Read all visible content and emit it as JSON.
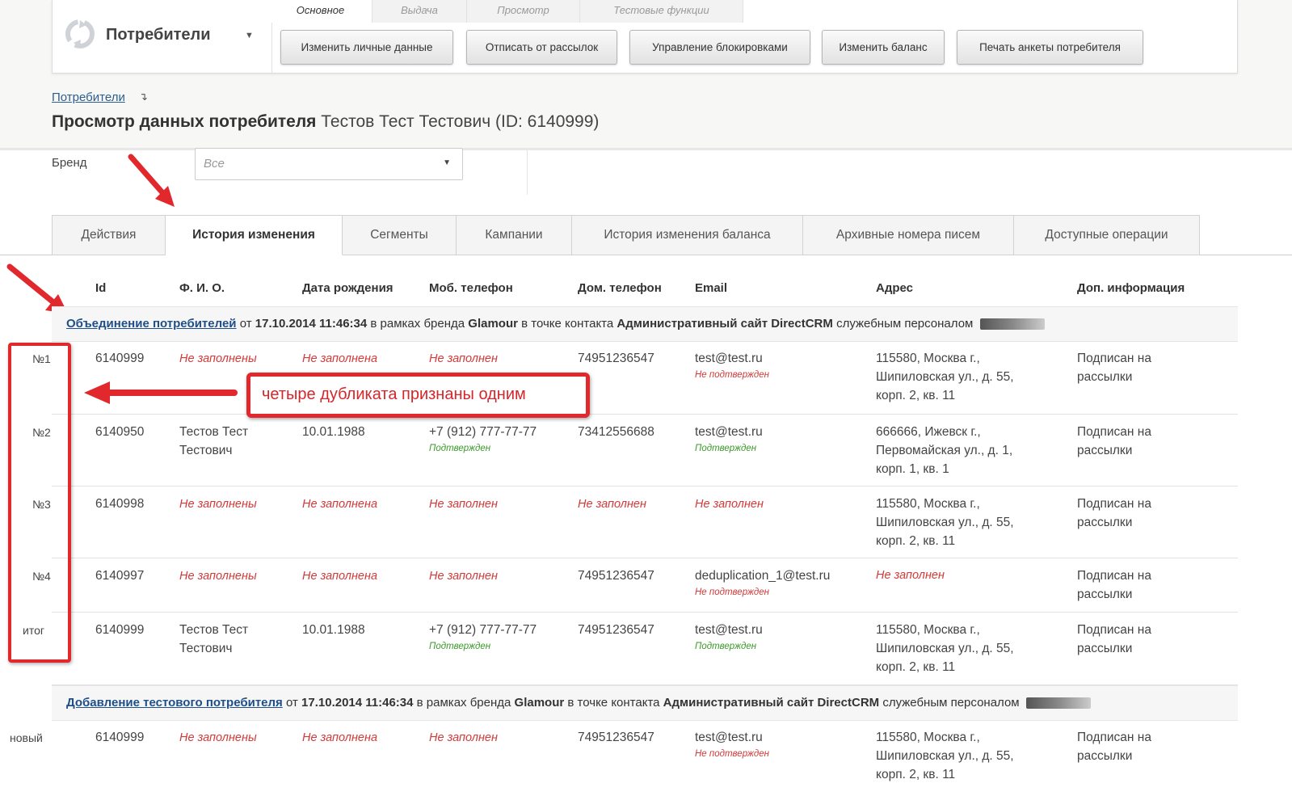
{
  "app": {
    "section_title": "Потребители",
    "ribbon_tabs": [
      "Основное",
      "Выдача",
      "Просмотр",
      "Тестовые функции"
    ],
    "toolbar_buttons": [
      "Изменить личные данные",
      "Отписать от рассылок",
      "Управление блокировками",
      "Изменить баланс",
      "Печать анкеты потребителя"
    ]
  },
  "breadcrumb": "Потребители",
  "page_title": {
    "bold": "Просмотр данных потребителя",
    "subject": "Тестов Тест Тестович (ID: 6140999)"
  },
  "brand_filter": {
    "label": "Бренд",
    "value": "Все"
  },
  "tabs": [
    "Действия",
    "История изменения",
    "Сегменты",
    "Кампании",
    "История изменения баланса",
    "Архивные номера писем",
    "Доступные операции"
  ],
  "columns": [
    "Id",
    "Ф. И. О.",
    "Дата рождения",
    "Моб. телефон",
    "Дом. телефон",
    "Email",
    "Адрес",
    "Доп. информация"
  ],
  "groups": [
    {
      "action": "Объединение потребителей",
      "t1": "от",
      "date": "17.10.2014 11:46:34",
      "t2": "в рамках бренда",
      "brand": "Glamour",
      "t3": "в точке контакта",
      "contact": "Административный сайт DirectCRM",
      "t4": "служебным персоналом"
    },
    {
      "action": "Добавление тестового потребителя",
      "t1": "от",
      "date": "17.10.2014 11:46:34",
      "t2": "в рамках бренда",
      "brand": "Glamour",
      "t3": "в точке контакта",
      "contact": "Административный сайт DirectCRM",
      "t4": "служебным персоналом"
    }
  ],
  "rows": [
    {
      "lead": "№1",
      "id": "6140999",
      "fio": "Не заполнены",
      "birth": "Не заполнена",
      "mob": "Не заполнен",
      "mob_status": "",
      "home": "74951236547",
      "email": "test@test.ru",
      "email_status": "Не подтвержден",
      "addr": [
        "115580, Москва г.,",
        "Шипиловская ул., д. 55,",
        "корп. 2, кв. 11"
      ],
      "info": [
        "Подписан на",
        "рассылки"
      ]
    },
    {
      "lead": "№2",
      "id": "6140950",
      "fio": "Тестов Тест Тестович",
      "birth": "10.01.1988",
      "mob": "+7 (912) 777-77-77",
      "mob_status": "Подтвержден",
      "home": "73412556688",
      "email": "test@test.ru",
      "email_status": "Подтвержден",
      "addr": [
        "666666, Ижевск г.,",
        "Первомайская ул., д. 1,",
        "корп. 1, кв. 1"
      ],
      "info": [
        "Подписан на",
        "рассылки"
      ]
    },
    {
      "lead": "№3",
      "id": "6140998",
      "fio": "Не заполнены",
      "birth": "Не заполнена",
      "mob": "Не заполнен",
      "mob_status": "",
      "home": "Не заполнен",
      "email": "Не заполнен",
      "email_status": "",
      "addr": [
        "115580, Москва г.,",
        "Шипиловская ул., д. 55,",
        "корп. 2, кв. 11"
      ],
      "info": [
        "Подписан на",
        "рассылки"
      ]
    },
    {
      "lead": "№4",
      "id": "6140997",
      "fio": "Не заполнены",
      "birth": "Не заполнена",
      "mob": "Не заполнен",
      "mob_status": "",
      "home": "74951236547",
      "email": "deduplication_1@test.ru",
      "email_status": "Не подтвержден",
      "addr": [
        "Не заполнен"
      ],
      "info": [
        "Подписан на",
        "рассылки"
      ]
    },
    {
      "lead": "итог",
      "id": "6140999",
      "fio": "Тестов Тест Тестович",
      "birth": "10.01.1988",
      "mob": "+7 (912) 777-77-77",
      "mob_status": "Подтвержден",
      "home": "74951236547",
      "email": "test@test.ru",
      "email_status": "Подтвержден",
      "addr": [
        "115580, Москва г.,",
        "Шипиловская ул., д. 55,",
        "корп. 2, кв. 11"
      ],
      "info": [
        "Подписан на",
        "рассылки"
      ]
    },
    {
      "lead": "новый",
      "id": "6140999",
      "fio": "Не заполнены",
      "birth": "Не заполнена",
      "mob": "Не заполнен",
      "mob_status": "",
      "home": "74951236547",
      "email": "test@test.ru",
      "email_status": "Не подтвержден",
      "addr": [
        "115580, Москва г.,",
        "Шипиловская ул., д. 55,",
        "корп. 2, кв. 11"
      ],
      "info": [
        "Подписан на",
        "рассылки"
      ]
    }
  ],
  "annotation": {
    "callout_text": "четыре дубликата признаны одним",
    "color": "#e0282d"
  }
}
